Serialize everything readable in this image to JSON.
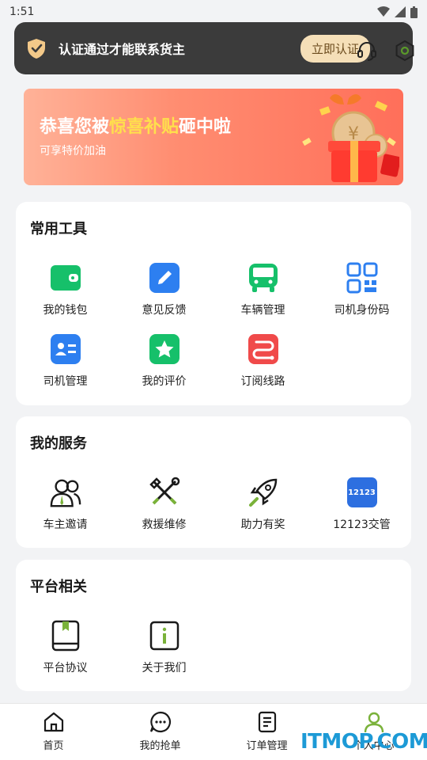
{
  "status_bar": {
    "time": "1:51"
  },
  "notice": {
    "text": "认证通过才能联系货主",
    "button": "立即认证"
  },
  "banner": {
    "title_prefix": "恭喜您被",
    "title_highlight": "惊喜补贴",
    "title_suffix": "砸中啦",
    "subtitle": "可享特价加油"
  },
  "tools": {
    "title": "常用工具",
    "items": [
      {
        "label": "我的钱包",
        "icon": "wallet-icon",
        "color": "#16c06a"
      },
      {
        "label": "意见反馈",
        "icon": "edit-icon",
        "color": "#2d7ff0"
      },
      {
        "label": "车辆管理",
        "icon": "bus-icon",
        "color": "#16c06a"
      },
      {
        "label": "司机身份码",
        "icon": "qrcode-icon",
        "color": "#2d7ff0"
      },
      {
        "label": "司机管理",
        "icon": "id-card-icon",
        "color": "#2d7ff0"
      },
      {
        "label": "我的评价",
        "icon": "star-icon",
        "color": "#16c06a"
      },
      {
        "label": "订阅线路",
        "icon": "route-icon",
        "color": "#f04a4a"
      }
    ]
  },
  "services": {
    "title": "我的服务",
    "items": [
      {
        "label": "车主邀请",
        "icon": "invite-icon"
      },
      {
        "label": "救援维修",
        "icon": "repair-icon"
      },
      {
        "label": "助力有奖",
        "icon": "rocket-icon"
      },
      {
        "label": "12123交管",
        "icon": "traffic-12123-icon",
        "badge": "12123"
      }
    ]
  },
  "platform": {
    "title": "平台相关",
    "items": [
      {
        "label": "平台协议",
        "icon": "book-icon"
      },
      {
        "label": "关于我们",
        "icon": "info-icon"
      }
    ]
  },
  "tabbar": {
    "items": [
      {
        "label": "首页",
        "icon": "home-icon"
      },
      {
        "label": "我的抢单",
        "icon": "chat-icon"
      },
      {
        "label": "订单管理",
        "icon": "document-icon"
      },
      {
        "label": "个人中心",
        "icon": "user-icon"
      }
    ]
  },
  "watermark": "ITMOP.COM"
}
